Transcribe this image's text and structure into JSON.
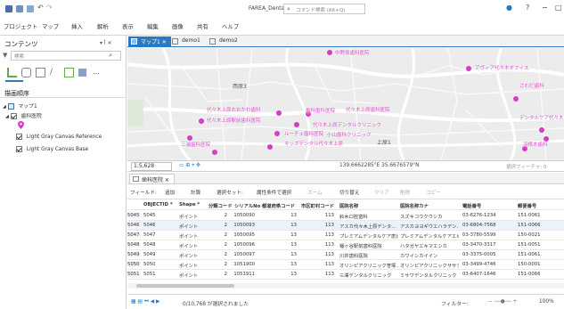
{
  "app": {
    "title": "FAREA_Dental",
    "search_placeholder": "コマンド検索 (Alt+Q)",
    "window_buttons": [
      "?",
      "−",
      "□"
    ]
  },
  "ribbon": {
    "tabs": [
      "プロジェクト",
      "マップ",
      "挿入",
      "解析",
      "表示",
      "編集",
      "画像",
      "共有",
      "ヘルプ"
    ]
  },
  "contents": {
    "title": "コンテンツ",
    "controls": "▾ ꟾ ✕",
    "filter_placeholder": "検索",
    "drawing_order_label": "描画順序",
    "layers": [
      {
        "label": "マップ1",
        "checked": true
      },
      {
        "label": "歯科医院",
        "checked": true
      },
      {
        "label": "Light Gray Canvas Reference",
        "checked": true
      },
      {
        "label": "Light Gray Canvas Base",
        "checked": true
      }
    ]
  },
  "map_tabs": [
    {
      "label": "マップ1 ✕",
      "active": true
    },
    {
      "label": "demo1",
      "active": false
    },
    {
      "label": "demo2",
      "active": false
    }
  ],
  "map": {
    "place_labels": [
      "西原3",
      "上原1"
    ],
    "poi_labels": [
      "中野坂歯科医院",
      "アヴィア代々木オフィス",
      "さわだ歯科",
      "歯科歯科医院",
      "代々木上原歯科医院",
      "代々木上原デンタルクリニック",
      "代々木上原おおかわ歯科",
      "代々木上原駅前歯科医院",
      "小山歯科クリニック",
      "デンタルケア代々木",
      "三浦歯科医院",
      "ルーチェ歯科医院",
      "キッズデンタル代々木上原",
      "羽根木歯科"
    ],
    "pin_color": "#d63cc4"
  },
  "map_status": {
    "scale": "1:5,628",
    "coordinates": "139.6662285°E 35.6676579°N",
    "selected_features": "選択フィーチャ: 0"
  },
  "table": {
    "tab_label": "歯科医院 ✕",
    "toolbar": [
      "フィールド:",
      "追加",
      "計算",
      "選択セット:",
      "属性条件で選択",
      "ズーム",
      "切り替え",
      "クリア",
      "削除",
      "コピー"
    ],
    "columns": [
      "OBJECTID *",
      "Shape *",
      "分類コード",
      "シリアルNo",
      "都道府県コード",
      "市区町村コード",
      "医院名称",
      "医院名称カナ",
      "電話番号",
      "郵便番号"
    ],
    "rows": [
      {
        "rownum": "5045",
        "cells": [
          "5045",
          "ポイント",
          "2",
          "1050090",
          "13",
          "113",
          "鈴木口腔歯科",
          "スズキコウクウシカ",
          "03-6276-1234",
          "151-0061"
        ]
      },
      {
        "rownum": "5046",
        "cells": [
          "5046",
          "ポイント",
          "2",
          "1050093",
          "13",
          "113",
          "アスカ代々木上原デンタ...",
          "アスカヨヨギウエハラデン...",
          "03-6804-7568",
          "151-0066"
        ]
      },
      {
        "rownum": "5047",
        "cells": [
          "5047",
          "ポイント",
          "2",
          "1050095",
          "13",
          "113",
          "プレミアムデンタルケア恵比...",
          "プレミアムデンタルケアエビス...",
          "03-3780-5599",
          "150-0021"
        ]
      },
      {
        "rownum": "5048",
        "cells": [
          "5048",
          "ポイント",
          "2",
          "1050096",
          "13",
          "113",
          "幡ヶ谷駅前歯科医院",
          "ハタガヤエキマエシカ",
          "03-3470-3317",
          "151-0051"
        ]
      },
      {
        "rownum": "5049",
        "cells": [
          "5049",
          "ポイント",
          "2",
          "1050097",
          "13",
          "113",
          "川井歯科医院",
          "カワイシカイイン",
          "03-3375-0005",
          "151-0061"
        ]
      },
      {
        "rownum": "5050",
        "cells": [
          "5050",
          "ポイント",
          "2",
          "1051900",
          "13",
          "113",
          "オリンピアクリニック笹塚...",
          "オリンピアクリニックササヅカ...",
          "03-3499-4746",
          "150-0001"
        ]
      },
      {
        "rownum": "5051",
        "cells": [
          "5051",
          "ポイント",
          "2",
          "1051911",
          "13",
          "113",
          "三澤デンタルクリニック",
          "ミサワデンタルクリニック",
          "03-6407-1646",
          "151-0066"
        ]
      }
    ],
    "footer_status": "0/10,768 が選択されました",
    "filter_label": "フィルター:",
    "zoom": "100%"
  }
}
